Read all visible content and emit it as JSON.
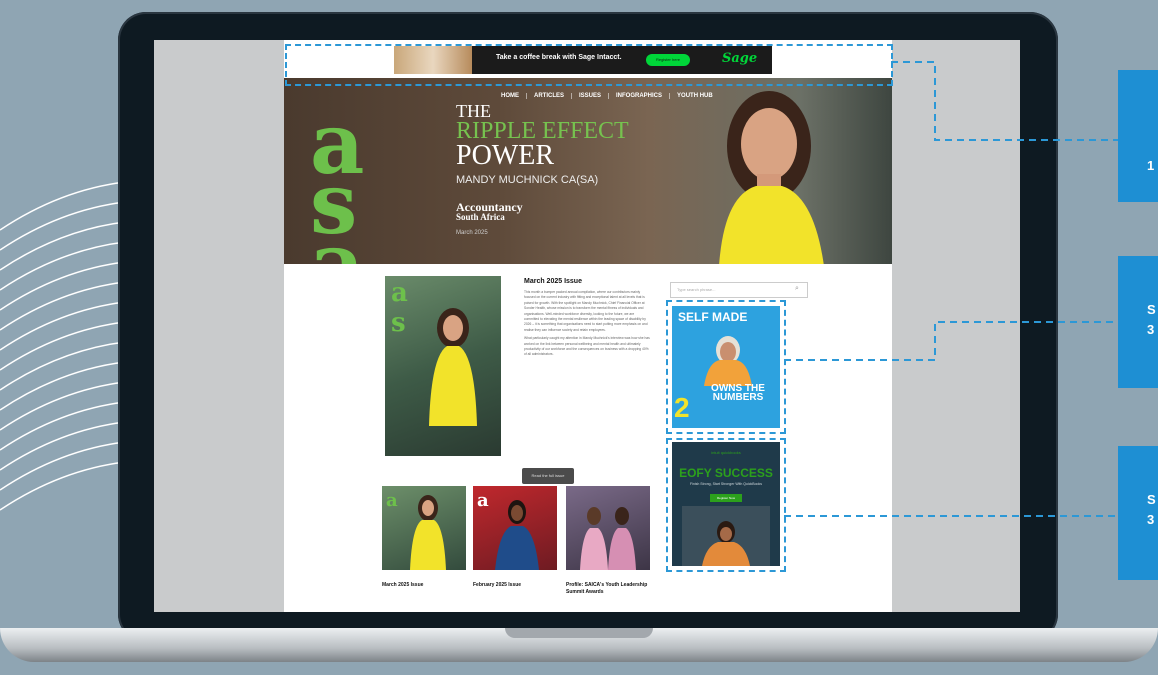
{
  "ad_banner": {
    "text": "Take a coffee break with Sage Intacct.",
    "button": "Register here",
    "brand": "Sage"
  },
  "nav": [
    "HOME",
    "ARTICLES",
    "ISSUES",
    "INFOGRAPHICS",
    "YOUTH HUB"
  ],
  "hero": {
    "logo": "asa",
    "the": "THE",
    "ripple": "RIPPLE EFFECT",
    "power": "POWER",
    "name": "MANDY MUCHNICK CA(SA)",
    "publication_line1": "Accountancy",
    "publication_line2": "South Africa",
    "date": "March 2025"
  },
  "issue": {
    "title": "March 2025 Issue",
    "body": "This month a bumper packed annual compilation, where our contributors mainly focused on the current industry with fitting and exceptional talent at all levels that is poised for growth. With the spotlight on Mandy Muchnick, Chief Financial Officer at Sonder Health, whose mission is to transform the mental fitness of individuals and organisations. Well-minded workforce diversity, looking to the future, we are committed to elevating the mental resilience within the leading space of disability by 2026 – it is something that organisations need to start putting more emphasis on and realise they can influence society and retain employees.",
    "body2": "What particularly caught my attention in Mandy Muchnick's interview was how she has worked on the link between personal wellbeing and mental health and ultimately productivity of our workforce and the consequences on business with a dropping 40% of all administrators.",
    "read_button": "Read the full issue"
  },
  "thumbs": [
    {
      "caption": "March 2025 Issue"
    },
    {
      "caption": "February 2025 Issue"
    },
    {
      "caption": "Profile: SAICA's Youth Leadership Summit Awards"
    }
  ],
  "search": {
    "placeholder": "Type search phrase..."
  },
  "ad_self_made": {
    "title": "SELF MADE",
    "bottom": "OWNS THE NUMBERS",
    "number": "2"
  },
  "ad_eofy": {
    "brand": "intuit quickbooks",
    "title": "EOFY SUCCESS",
    "subtitle": "Finish Strong, Start Stronger With QuickBooks",
    "button": "Register Now"
  },
  "callouts": [
    {
      "text": "1"
    },
    {
      "text": "S\n3"
    },
    {
      "text": "S\n3"
    }
  ],
  "colors": {
    "accent_blue": "#1e8fd3",
    "asa_green": "#6dc04b",
    "sage_green": "#00d639",
    "self_made_blue": "#2da2df",
    "quickbooks_green": "#2ca01c"
  }
}
